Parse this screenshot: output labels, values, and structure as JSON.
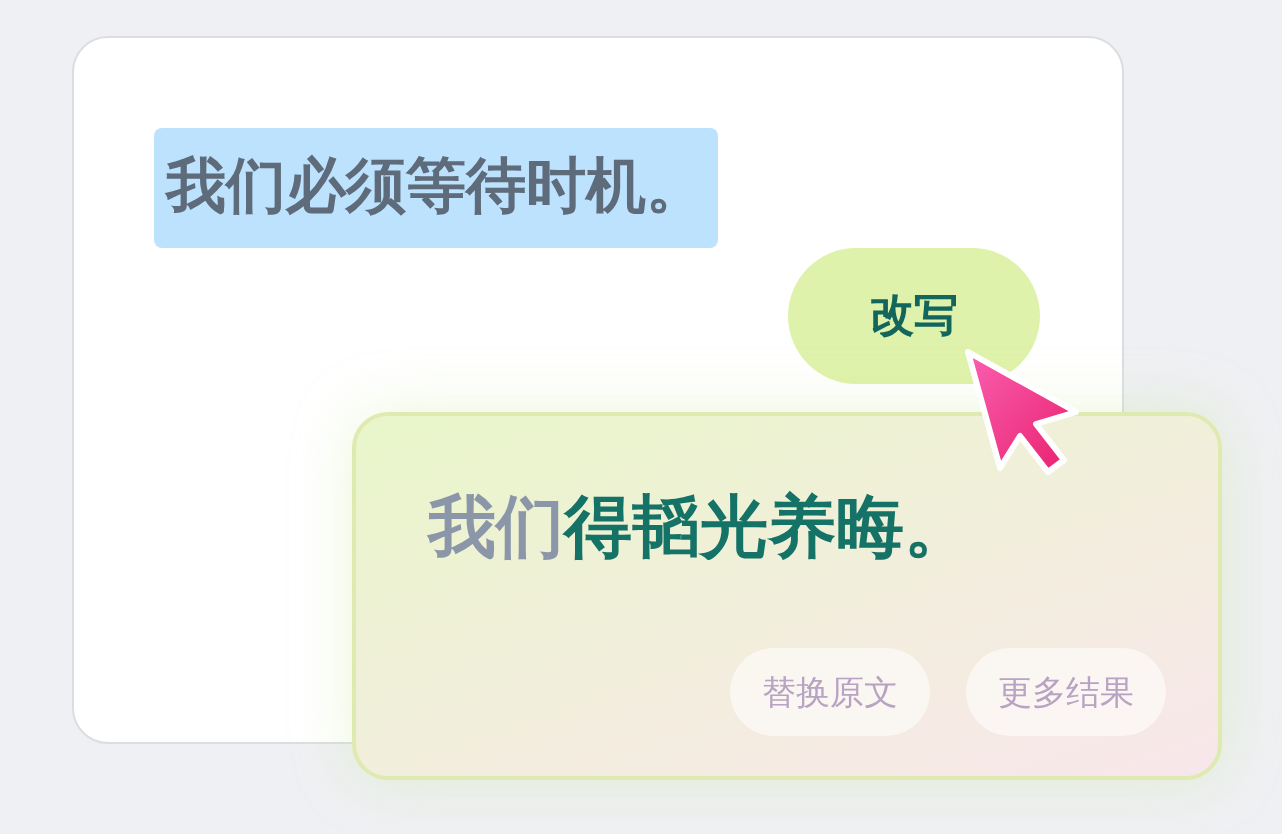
{
  "source": {
    "text": "我们必须等待时机。",
    "selected": true
  },
  "rewrite_button": {
    "label": "改写"
  },
  "result": {
    "segments": [
      {
        "text": "我们",
        "changed": false
      },
      {
        "text": "得韬光养晦。",
        "changed": true
      }
    ],
    "actions": [
      {
        "label": "替换原文"
      },
      {
        "label": "更多结果"
      }
    ]
  }
}
